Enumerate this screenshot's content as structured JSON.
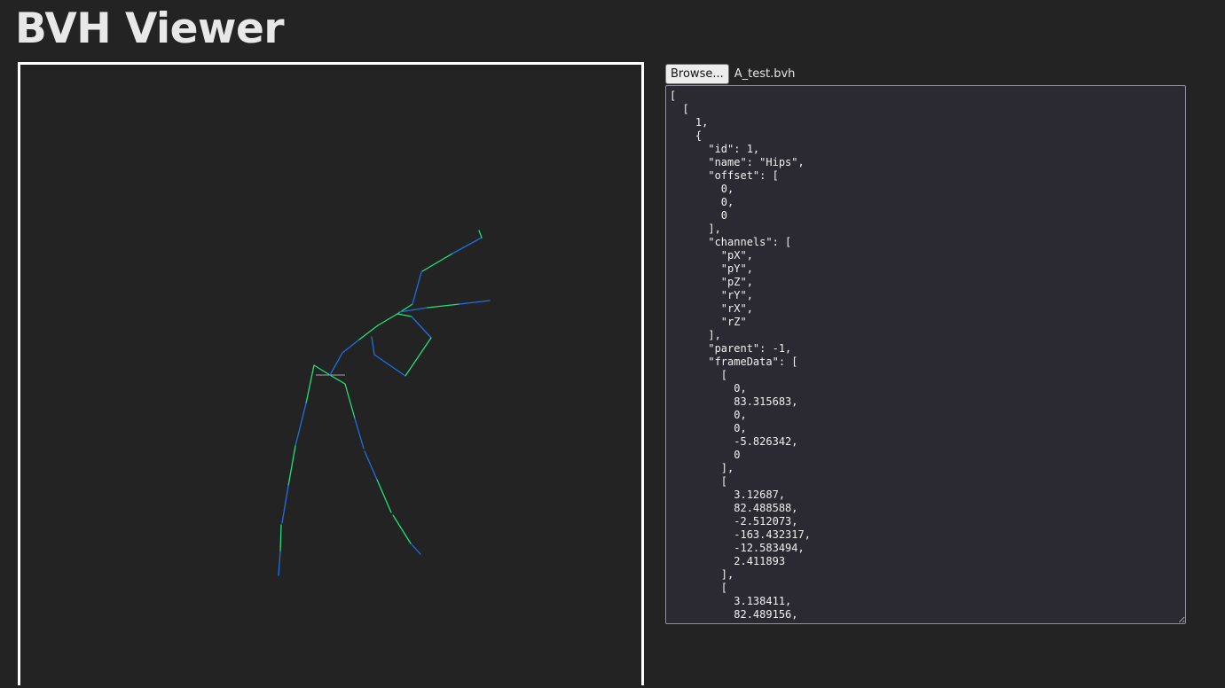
{
  "header": {
    "title": "BVH Viewer"
  },
  "file_picker": {
    "browse_label": "Browse...",
    "file_name": "A_test.bvh"
  },
  "json_output": {
    "text": "[\n  [\n    1,\n    {\n      \"id\": 1,\n      \"name\": \"Hips\",\n      \"offset\": [\n        0,\n        0,\n        0\n      ],\n      \"channels\": [\n        \"pX\",\n        \"pY\",\n        \"pZ\",\n        \"rY\",\n        \"rX\",\n        \"rZ\"\n      ],\n      \"parent\": -1,\n      \"frameData\": [\n        [\n          0,\n          83.315683,\n          0,\n          0,\n          -5.826342,\n          0\n        ],\n        [\n          3.12687,\n          82.488588,\n          -2.512073,\n          -163.432317,\n          -12.583494,\n          2.411893\n        ],\n        [\n          3.138411,\n          82.489156,\n          ..."
  },
  "colors": {
    "background": "#232323",
    "viewport_border": "#ffffff",
    "bone_green": "#22e07a",
    "bone_blue": "#1f6fe0",
    "ground_gray": "#8a8a8a"
  }
}
